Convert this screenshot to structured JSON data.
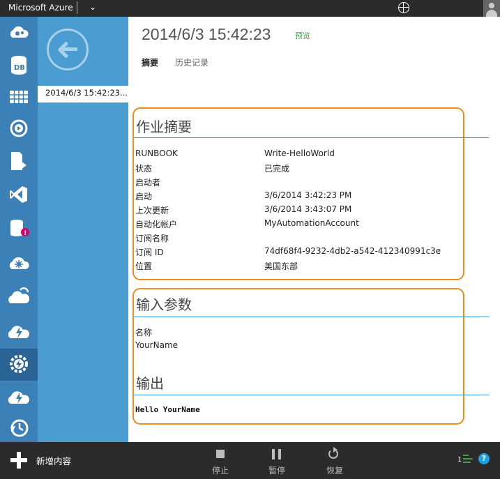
{
  "topbar": {
    "brand": "Microsoft Azure",
    "chevron": "⌄",
    "globe_icon": "globe-icon",
    "avatar_icon": "user-avatar-icon"
  },
  "leftnav": {
    "items": [
      {
        "icon": "web-sites-icon"
      },
      {
        "icon": "database-icon"
      },
      {
        "icon": "storage-table-icon"
      },
      {
        "icon": "media-services-icon"
      },
      {
        "icon": "mobile-services-icon"
      },
      {
        "icon": "visual-studio-icon"
      },
      {
        "icon": "cache-warning-icon",
        "badge": "!"
      },
      {
        "icon": "hdinsight-icon"
      },
      {
        "icon": "cloud-services-icon"
      },
      {
        "icon": "cloud-lightning-icon"
      },
      {
        "icon": "automation-icon",
        "active": true
      },
      {
        "icon": "scheduler-cloud-icon"
      },
      {
        "icon": "recovery-icon"
      }
    ]
  },
  "sidepanel": {
    "back_icon": "back-arrow-icon",
    "selected_item": "2014/6/3 15:42:23..."
  },
  "header": {
    "title": "2014/6/3 15:42:23",
    "preview": "预览"
  },
  "tabs": [
    {
      "label": "摘要"
    },
    {
      "label": "历史记录"
    }
  ],
  "job_summary": {
    "title": "作业摘要",
    "rows": [
      {
        "key": "RUNBOOK",
        "value": "Write-HelloWorld"
      },
      {
        "key": "状态",
        "value": "已完成"
      },
      {
        "key": "启动者",
        "value": ""
      },
      {
        "key": "启动",
        "value": "3/6/2014 3:42:23 PM"
      },
      {
        "key": "上次更新",
        "value": "3/6/2014 3:43:07 PM"
      },
      {
        "key": "自动化帐户",
        "value": "MyAutomationAccount"
      },
      {
        "key": "订阅名称",
        "value": ""
      },
      {
        "key": "订阅 ID",
        "value": "74df68f4-9232-4db2-a542-412340991c3e"
      },
      {
        "key": "位置",
        "value": "美国东部"
      }
    ]
  },
  "input_params": {
    "title": "输入参数",
    "name_label": "名称",
    "name_value": "YourName"
  },
  "output": {
    "title": "输出",
    "text": "Hello YourName"
  },
  "bottombar": {
    "new_label": "新增内容",
    "commands": [
      {
        "label": "停止"
      },
      {
        "label": "暂停"
      },
      {
        "label": "恢复"
      }
    ],
    "count": "1",
    "help": "?"
  },
  "colors": {
    "accent_blue": "#3b80b6",
    "panel_blue": "#4b9cd1",
    "highlight_orange": "#f08c1a",
    "preview_green": "#3fa43f"
  }
}
